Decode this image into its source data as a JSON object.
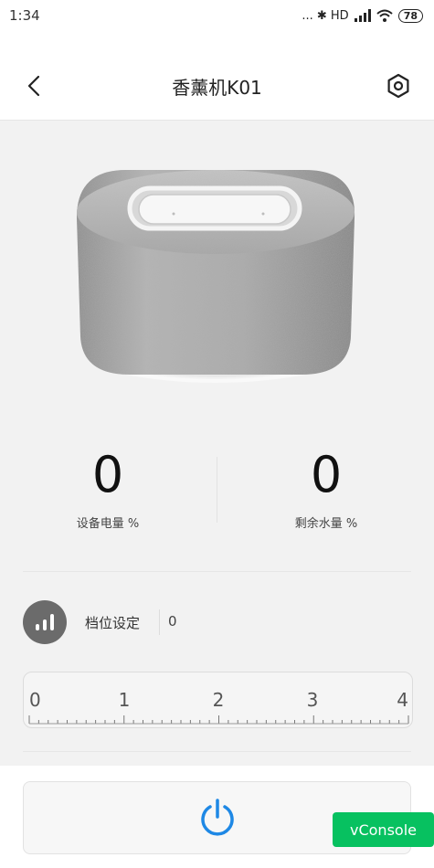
{
  "status_bar": {
    "time": "1:34",
    "indicators": "... ✱ HD",
    "battery": "78"
  },
  "header": {
    "title": "香薰机K01",
    "back_icon": "chevron-left-icon",
    "settings_icon": "hex-settings-icon"
  },
  "stats": {
    "battery": {
      "value": "0",
      "label": "设备电量 %"
    },
    "water": {
      "value": "0",
      "label": "剩余水量 %"
    }
  },
  "gear": {
    "label": "档位设定",
    "value": "0",
    "icon": "signal-bars-icon"
  },
  "slider": {
    "ticks": [
      "0",
      "1",
      "2",
      "3",
      "4"
    ],
    "value": 0
  },
  "power": {
    "icon": "power-icon"
  },
  "vconsole": {
    "label": "vConsole"
  },
  "colors": {
    "accent": "#1e88e5",
    "vconsole": "#07c160",
    "gear_bg": "#6b6b6b"
  }
}
